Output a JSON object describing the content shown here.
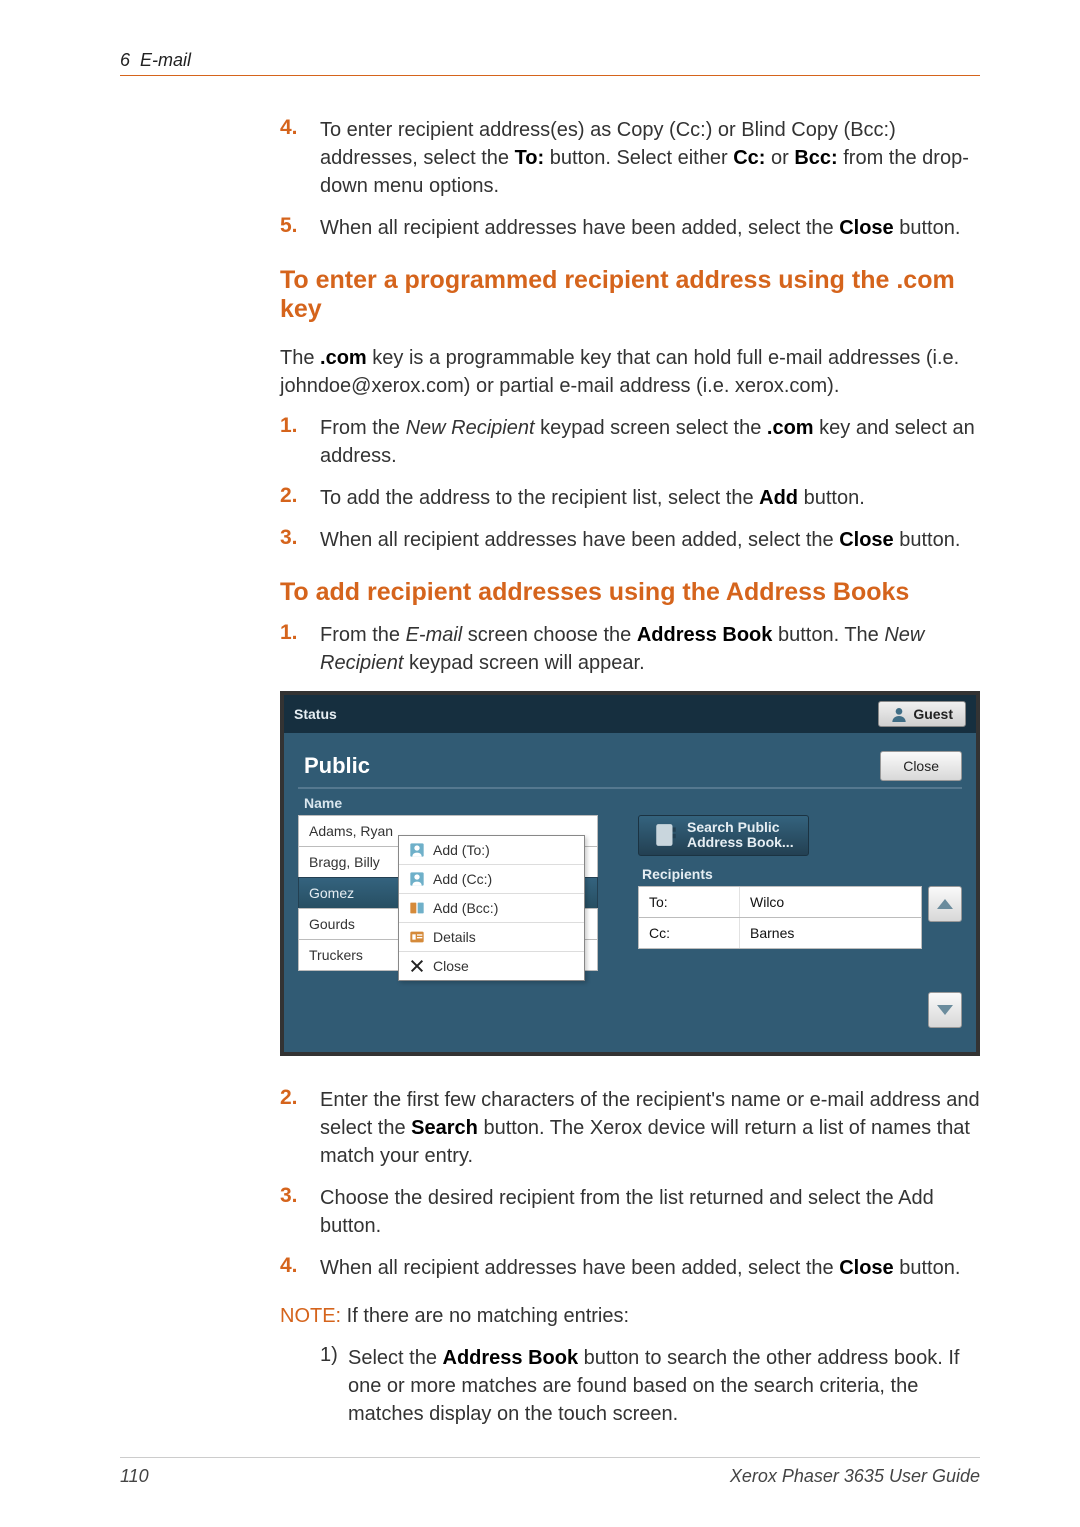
{
  "header": {
    "chapter_num": "6",
    "chapter_title": "E-mail"
  },
  "steps_a": {
    "n4": "4.",
    "t4_a": "To enter recipient address(es) as Copy (Cc:) or Blind Copy (Bcc:) addresses, select the ",
    "t4_b": "To:",
    "t4_c": " button. Select either ",
    "t4_d": "Cc:",
    "t4_e": " or ",
    "t4_f": "Bcc:",
    "t4_g": " from the drop-down menu options.",
    "n5": "5.",
    "t5_a": "When all recipient addresses have been added, select the ",
    "t5_b": "Close",
    "t5_c": " button."
  },
  "section_com": {
    "title": "To enter a programmed recipient address using the .com key",
    "intro_a": "The ",
    "intro_b": ".com",
    "intro_c": " key is a programmable key that can hold full e-mail addresses (i.e. johndoe@xerox.com) or partial e-mail address (i.e. xerox.com).",
    "n1": "1.",
    "s1_a": "From the ",
    "s1_b": "New Recipient",
    "s1_c": " keypad screen select the ",
    "s1_d": ".com",
    "s1_e": " key and select an address.",
    "n2": "2.",
    "s2_a": "To add the address to the recipient list, select the ",
    "s2_b": "Add",
    "s2_c": " button.",
    "n3": "3.",
    "s3_a": "When all recipient addresses have been added, select the ",
    "s3_b": "Close",
    "s3_c": " button."
  },
  "section_ab": {
    "title": "To add recipient addresses using the Address Books",
    "n1": "1.",
    "s1_a": "From the ",
    "s1_b": "E-mail",
    "s1_c": " screen choose the ",
    "s1_d": "Address Book",
    "s1_e": " button. The ",
    "s1_f": "New Recipient",
    "s1_g": " keypad screen will appear."
  },
  "ui": {
    "status": "Status",
    "guest": "Guest",
    "title": "Public",
    "close": "Close",
    "name_header": "Name",
    "names": [
      "Adams, Ryan",
      "Bragg, Billy",
      "Gomez",
      "Gourds",
      "Truckers"
    ],
    "dropdown": {
      "add_to": "Add (To:)",
      "add_cc": "Add (Cc:)",
      "add_bcc": "Add (Bcc:)",
      "details": "Details",
      "close": "Close"
    },
    "search_l1": "Search Public",
    "search_l2": "Address Book...",
    "recip_header": "Recipients",
    "rows": [
      {
        "type": "To:",
        "val": "Wilco"
      },
      {
        "type": "Cc:",
        "val": "Barnes"
      }
    ]
  },
  "post": {
    "n2": "2.",
    "s2_a": "Enter the first few characters of the recipient's name or e-mail address and select the ",
    "s2_b": "Search",
    "s2_c": " button. The Xerox device will return a list of names that match your entry.",
    "n3": "3.",
    "s3": "Choose the desired recipient from the list returned and select the Add button.",
    "n4": "4.",
    "s4_a": "When all recipient addresses have been added, select the ",
    "s4_b": "Close",
    "s4_c": " button.",
    "note_label": "NOTE:",
    "note_text": " If there are no matching entries:",
    "sub_n": "1)",
    "sub_a": "Select the ",
    "sub_b": "Address Book",
    "sub_c": " button to search the other address book. If one or more matches are found based on the search criteria, the matches display on the touch screen."
  },
  "footer": {
    "page": "110",
    "guide": "Xerox Phaser 3635 User Guide"
  }
}
